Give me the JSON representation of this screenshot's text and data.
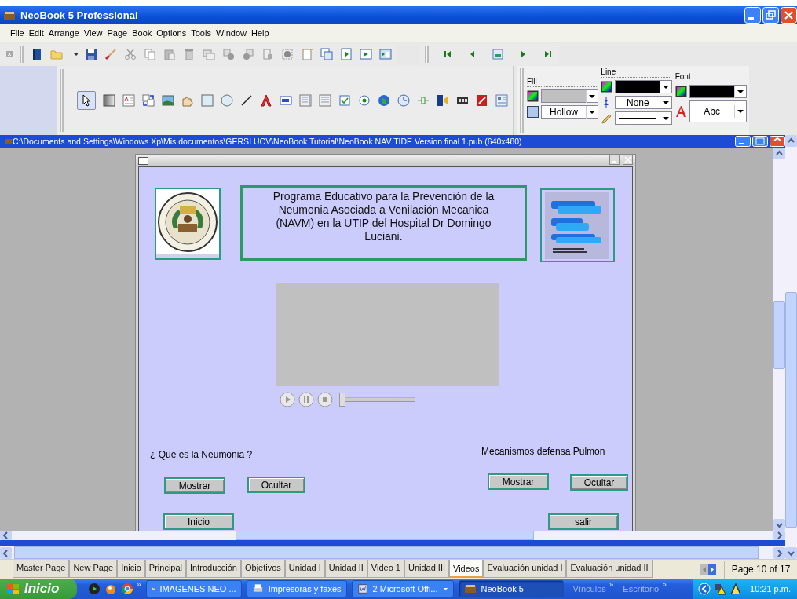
{
  "window": {
    "title": "NeoBook 5 Professional"
  },
  "menu": [
    "File",
    "Edit",
    "Arrange",
    "View",
    "Page",
    "Book",
    "Options",
    "Tools",
    "Window",
    "Help"
  ],
  "properties_panel": {
    "fill": {
      "label": "Fill",
      "color": "#c0c0c0",
      "style": "Hollow"
    },
    "line": {
      "label": "Line",
      "color": "#000000",
      "style": "None"
    },
    "font": {
      "label": "Font",
      "color": "#000000",
      "sample": "Abc"
    }
  },
  "document": {
    "title": "C:\\Documents and Settings\\Windows Xp\\Mis documentos\\GERSI UCV\\NeoBook Tutorial\\NeoBook NAV TIDE Version final 1.pub (640x480)"
  },
  "page": {
    "heading": "Programa Educativo para la Prevención de la Neumonia Asociada a Venilación Mecanica (NAVM) en la UTIP del Hospital Dr Domingo Luciani.",
    "video_player": {
      "level": 0
    },
    "labels": [
      "¿ Que es la Neumonia ?",
      "Mecanismos defensa Pulmon"
    ],
    "buttons": [
      "Mostrar",
      "Ocultar",
      "Mostrar",
      "Ocultar",
      "Inicio",
      "salir"
    ]
  },
  "page_tabs": [
    {
      "label": "Master Page",
      "selected": false
    },
    {
      "label": "New Page",
      "selected": false
    },
    {
      "label": "Inicio",
      "selected": false
    },
    {
      "label": "Principal",
      "selected": false
    },
    {
      "label": "Introducción",
      "selected": false
    },
    {
      "label": "Objetivos",
      "selected": false
    },
    {
      "label": "Unidad I",
      "selected": false
    },
    {
      "label": "Unidad II",
      "selected": false
    },
    {
      "label": "Video 1",
      "selected": false
    },
    {
      "label": "Unidad III",
      "selected": false
    },
    {
      "label": "Videos",
      "selected": true
    },
    {
      "label": "Evaluación unidad I",
      "selected": false
    },
    {
      "label": "Evaluación unidad II",
      "selected": false
    }
  ],
  "page_counter": "Page 10 of 17",
  "taskbar": {
    "start": "Inicio",
    "quick_launch_more": "»",
    "tasks": [
      {
        "label": "IMAGENES NEO ...",
        "selected": false
      },
      {
        "label": "Impresoras y faxes",
        "selected": false
      },
      {
        "label": "2 Microsoft Offi...",
        "selected": false
      },
      {
        "label": "NeoBook 5",
        "selected": true
      }
    ],
    "toolbars": [
      {
        "label": "Vínculos",
        "more": "»"
      },
      {
        "label": "Escritorio",
        "more": "»"
      }
    ],
    "clock": "10:21 p.m."
  }
}
